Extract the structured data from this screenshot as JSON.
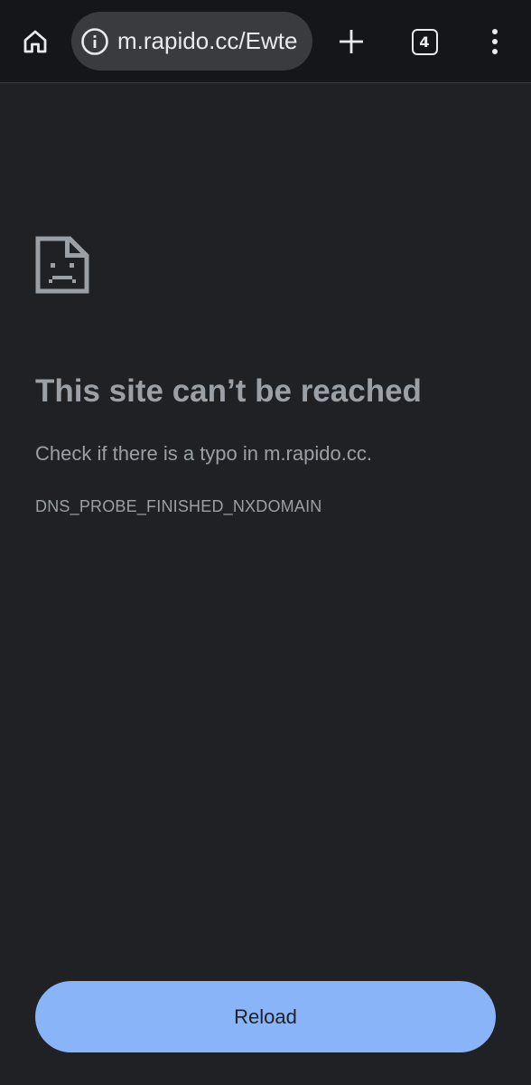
{
  "browser": {
    "url": "m.rapido.cc/Ewte",
    "tab_count": "4",
    "icons": {
      "home": "home-icon",
      "site_info": "info-icon",
      "new_tab": "plus-icon",
      "tab_switcher": "tab-count-icon",
      "menu": "more-vert-icon"
    }
  },
  "error_page": {
    "icon": "sad-document-icon",
    "title": "This site can’t be reached",
    "description": "Check if there is a typo in m.rapido.cc.",
    "error_code": "DNS_PROBE_FINISHED_NXDOMAIN",
    "reload_label": "Reload"
  },
  "colors": {
    "background": "#202124",
    "toolbar": "#15161a",
    "omnibox": "#3a3b3f",
    "text_secondary": "#9aa0a6",
    "accent": "#8ab4f8"
  }
}
